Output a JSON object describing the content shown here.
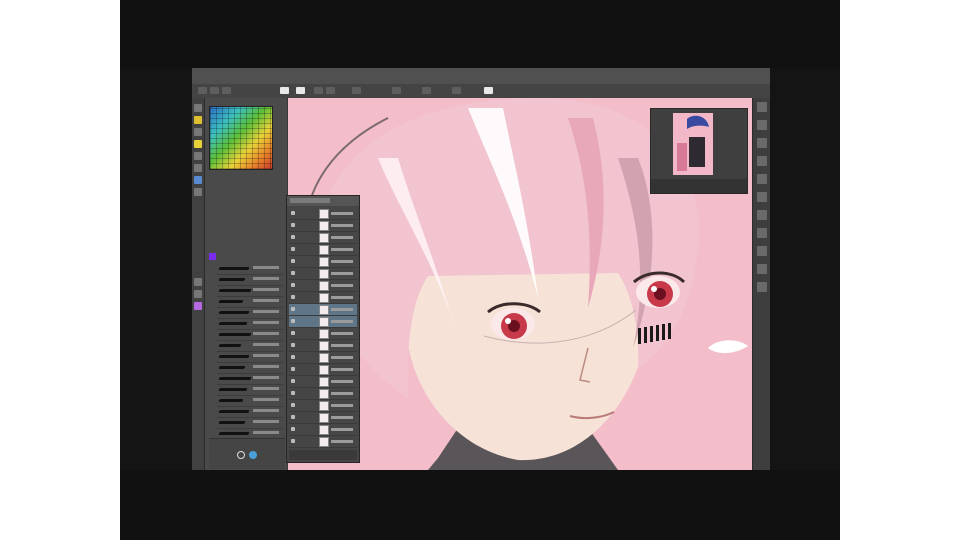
{
  "app": {
    "window_title": "",
    "menu": [
      "",
      "",
      "",
      "",
      "",
      "",
      "",
      "",
      "",
      ""
    ]
  },
  "colors": {
    "canvas_background": "#f3bdca",
    "ui_dark": "#3a3a3a",
    "active_layer": "#5f7688",
    "accent_purple": "#7a2cf0"
  },
  "panels": {
    "tools": {
      "items": [
        "pen-tool",
        "brush-tool",
        "eraser-tool",
        "fill-tool",
        "select-tool",
        "move-tool",
        "text-tool",
        "eyedropper-tool"
      ]
    },
    "brushes": {
      "count": 16
    },
    "layers": {
      "count": 20,
      "active_index": 7
    },
    "navigator": {
      "shown": true
    }
  }
}
